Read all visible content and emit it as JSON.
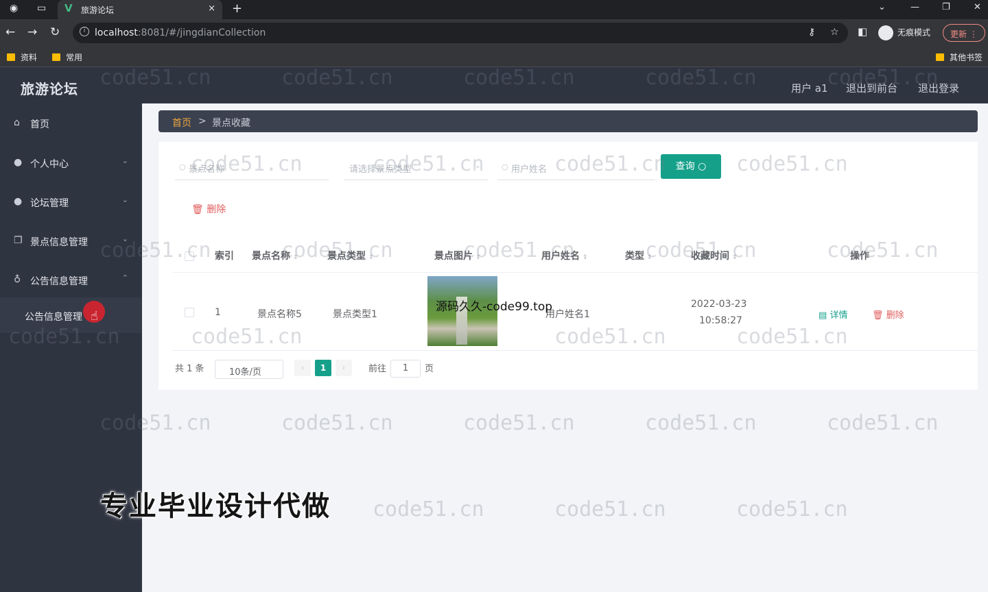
{
  "browser": {
    "tab_title": "旅游论坛",
    "tab_close": "×",
    "new_tab": "+",
    "url_host": "localhost",
    "url_path": ":8081/#/jingdianCollection",
    "incognito_label": "无痕模式",
    "update_label": "更新",
    "bookmarks": [
      "资料",
      "常用"
    ],
    "other_bookmarks": "其他书签"
  },
  "header": {
    "title": "旅游论坛",
    "user": "用户 a1",
    "back_to_front": "退出到前台",
    "logout": "退出登录"
  },
  "sidebar": {
    "items": [
      {
        "label": "首页",
        "icon": "home-icon"
      },
      {
        "label": "个人中心",
        "icon": "user-icon"
      },
      {
        "label": "论坛管理",
        "icon": "user-icon"
      },
      {
        "label": "景点信息管理",
        "icon": "copy-icon"
      },
      {
        "label": "公告信息管理",
        "icon": "mic-icon"
      }
    ],
    "sub_item": "公告信息管理"
  },
  "breadcrumb": {
    "home": "首页",
    "separator": ">",
    "current": "景点收藏"
  },
  "search": {
    "name_placeholder": "景点名称",
    "type_placeholder": "请选择景点类型",
    "user_placeholder": "用户姓名",
    "query_button": "查询"
  },
  "delete_button": "删除",
  "table": {
    "headers": [
      "索引",
      "景点名称",
      "景点类型",
      "景点图片",
      "用户姓名",
      "类型",
      "收藏时间",
      "操作"
    ],
    "rows": [
      {
        "index": "1",
        "name": "景点名称5",
        "type": "景点类型1",
        "image_overlay": "源码久久-code99.top",
        "user": "用户姓名1",
        "time_date": "2022-03-23",
        "time_clock": "10:58:27",
        "detail": "详情",
        "delete": "删除"
      }
    ]
  },
  "pagination": {
    "total": "共 1 条",
    "page_size": "10条/页",
    "current_page": "1",
    "goto_label": "前往",
    "goto_value": "1",
    "page_suffix": "页"
  },
  "promo_text": "专业毕业设计代做",
  "watermark": "code51.cn",
  "colors": {
    "accent": "#15a08a",
    "danger": "#e15d5d",
    "breadcrumb_home": "#e9a53d"
  }
}
